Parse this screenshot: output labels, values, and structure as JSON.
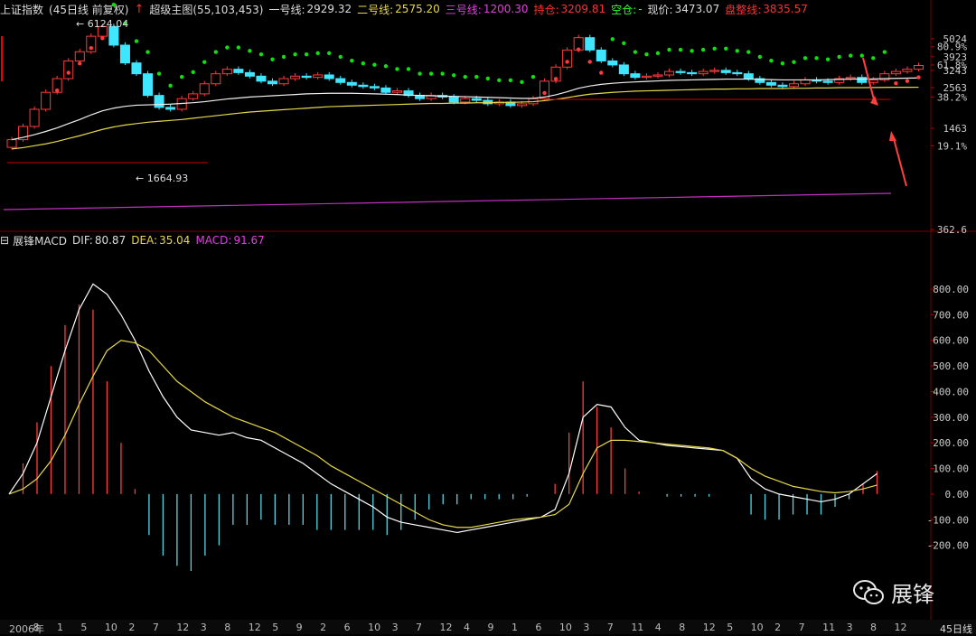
{
  "top_header": {
    "index_name": "上证指数",
    "period_info": "(45日线 前复权)",
    "indicator_name": "超级主图(55,103,453)",
    "line1_label": "一号线:",
    "line1_value": "2929.32",
    "line2_label": "二号线:",
    "line2_value": "2575.20",
    "line3_label": "三号线:",
    "line3_value": "1200.30",
    "hold_label": "持仓:",
    "hold_value": "3209.81",
    "empty_label": "空仓:",
    "empty_value": "-",
    "price_label": "现价:",
    "price_value": "3473.07",
    "consolidation_label": "盘整线:",
    "consolidation_value": "3835.57"
  },
  "macd_header": {
    "name": "展锋MACD",
    "dif_label": "DIF:",
    "dif_value": "80.87",
    "dea_label": "DEA:",
    "dea_value": "35.04",
    "macd_label": "MACD:",
    "macd_value": "91.67"
  },
  "price_axis": [
    {
      "label": "5024",
      "pct": ""
    },
    {
      "label": "",
      "pct": "80.9%"
    },
    {
      "label": "3923",
      "pct": ""
    },
    {
      "label": "",
      "pct": "61.8%"
    },
    {
      "label": "3243",
      "pct": ""
    },
    {
      "label": "2563",
      "pct": ""
    },
    {
      "label": "",
      "pct": "38.2%"
    },
    {
      "label": "1463",
      "pct": ""
    },
    {
      "label": "",
      "pct": "19.1%"
    },
    {
      "label": "362.6",
      "pct": ""
    }
  ],
  "macd_axis": [
    "800.00",
    "700.00",
    "600.00",
    "500.00",
    "400.00",
    "300.00",
    "200.00",
    "100.00",
    "0.00",
    "-100.00",
    "-200.00"
  ],
  "annotations": {
    "high": "6124.04",
    "low": "1664.93"
  },
  "x_axis": [
    "2006年",
    "8",
    "1",
    "5",
    "10",
    "2",
    "7",
    "12",
    "3",
    "8",
    "12",
    "5",
    "9",
    "2",
    "6",
    "10",
    "3",
    "7",
    "12",
    "4",
    "9",
    "1",
    "6",
    "10",
    "3",
    "7",
    "11",
    "4",
    "8",
    "12",
    "5",
    "10",
    "2",
    "7",
    "11",
    "3",
    "8",
    "12"
  ],
  "period_button": "45日线",
  "watermark": "展锋",
  "colors": {
    "up": "#ff3b3b",
    "down": "#3ee6ff",
    "dif": "#ffffff",
    "dea": "#e6d84a",
    "third_line": "#c030c0",
    "sar": "#10e010"
  },
  "chart_data": {
    "type": "candlestick",
    "price_series": {
      "close": [
        1250,
        1500,
        1900,
        2400,
        2900,
        3700,
        4200,
        5200,
        5950,
        4600,
        3600,
        3100,
        2300,
        1950,
        1900,
        2200,
        2350,
        2700,
        3100,
        3300,
        3150,
        3000,
        2800,
        2700,
        2900,
        3000,
        2950,
        3050,
        2900,
        2750,
        2650,
        2600,
        2550,
        2400,
        2450,
        2300,
        2200,
        2300,
        2250,
        2100,
        2200,
        2150,
        2050,
        2100,
        2000,
        2050,
        2200,
        2800,
        3400,
        4300,
        5100,
        4300,
        3700,
        3500,
        3100,
        2950,
        3000,
        3050,
        3200,
        3150,
        3100,
        3200,
        3250,
        3150,
        3100,
        2900,
        2750,
        2650,
        2600,
        2700,
        2850,
        2800,
        2750,
        2900,
        2950,
        2750,
        2850,
        3100,
        3200,
        3300,
        3473
      ],
      "ma_white_line1": [
        1250,
        1290,
        1340,
        1400,
        1470,
        1560,
        1650,
        1760,
        1860,
        1930,
        1980,
        2010,
        2020,
        2030,
        2040,
        2060,
        2080,
        2110,
        2150,
        2190,
        2220,
        2250,
        2270,
        2290,
        2310,
        2330,
        2350,
        2360,
        2370,
        2370,
        2370,
        2360,
        2350,
        2340,
        2330,
        2310,
        2300,
        2290,
        2280,
        2270,
        2260,
        2250,
        2240,
        2230,
        2220,
        2210,
        2210,
        2250,
        2320,
        2420,
        2540,
        2620,
        2680,
        2720,
        2750,
        2770,
        2790,
        2810,
        2830,
        2840,
        2850,
        2860,
        2870,
        2880,
        2880,
        2880,
        2870,
        2860,
        2850,
        2850,
        2850,
        2850,
        2860,
        2870,
        2880,
        2880,
        2890,
        2900,
        2910,
        2920,
        2929
      ],
      "ma_yellow_line2": [
        1100,
        1120,
        1150,
        1180,
        1220,
        1270,
        1320,
        1380,
        1440,
        1490,
        1530,
        1560,
        1590,
        1610,
        1630,
        1650,
        1680,
        1710,
        1740,
        1770,
        1800,
        1830,
        1850,
        1870,
        1890,
        1910,
        1930,
        1950,
        1970,
        1980,
        1990,
        2000,
        2010,
        2020,
        2030,
        2040,
        2050,
        2060,
        2060,
        2070,
        2070,
        2080,
        2080,
        2090,
        2090,
        2100,
        2110,
        2140,
        2180,
        2230,
        2290,
        2340,
        2370,
        2400,
        2420,
        2440,
        2450,
        2460,
        2470,
        2480,
        2490,
        2500,
        2510,
        2510,
        2520,
        2520,
        2530,
        2530,
        2530,
        2540,
        2540,
        2550,
        2550,
        2560,
        2560,
        2560,
        2565,
        2570,
        2572,
        2574,
        2575
      ],
      "line3_value": 1200.3
    },
    "macd": {
      "dif": [
        0,
        80,
        200,
        380,
        560,
        720,
        820,
        780,
        700,
        600,
        480,
        380,
        300,
        250,
        240,
        230,
        240,
        220,
        210,
        180,
        150,
        120,
        80,
        40,
        10,
        -20,
        -50,
        -90,
        -110,
        -120,
        -130,
        -140,
        -150,
        -140,
        -130,
        -120,
        -110,
        -100,
        -90,
        -60,
        80,
        300,
        350,
        340,
        260,
        210,
        200,
        190,
        185,
        180,
        175,
        170,
        140,
        60,
        20,
        0,
        -10,
        -20,
        -30,
        -20,
        0,
        40,
        80
      ],
      "dea": [
        0,
        20,
        60,
        130,
        230,
        350,
        460,
        560,
        600,
        590,
        560,
        500,
        440,
        400,
        360,
        330,
        300,
        280,
        260,
        240,
        210,
        180,
        150,
        110,
        80,
        50,
        20,
        -10,
        -40,
        -70,
        -100,
        -120,
        -130,
        -130,
        -120,
        -110,
        -100,
        -95,
        -90,
        -80,
        -40,
        80,
        180,
        210,
        210,
        205,
        200,
        195,
        190,
        185,
        180,
        170,
        140,
        100,
        70,
        50,
        30,
        20,
        10,
        5,
        10,
        20,
        35
      ],
      "hist_range": [
        -420,
        920
      ]
    }
  }
}
